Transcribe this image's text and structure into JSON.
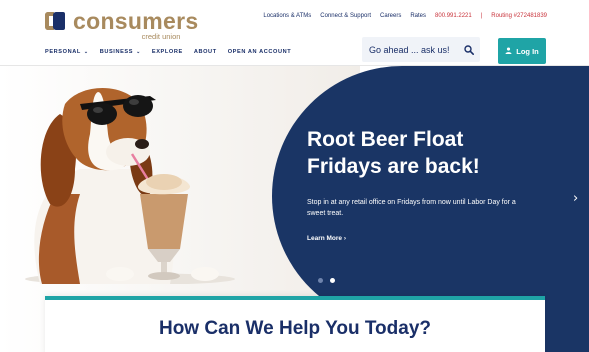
{
  "brand": {
    "name": "consumers",
    "tagline": "credit union",
    "colors": {
      "gold": "#a88a5e",
      "navy": "#1a2f68",
      "teal": "#1fa4a6",
      "red": "#c8323a",
      "hero_blue": "#1a3565"
    }
  },
  "utility_nav": {
    "links": [
      "Locations & ATMs",
      "Connect & Support",
      "Careers",
      "Rates"
    ],
    "phone": "800.991.2221",
    "separator": "|",
    "routing": "Routing #272481839"
  },
  "main_nav": {
    "items": [
      {
        "label": "PERSONAL",
        "has_dropdown": true
      },
      {
        "label": "BUSINESS",
        "has_dropdown": true
      },
      {
        "label": "EXPLORE",
        "has_dropdown": false
      },
      {
        "label": "ABOUT",
        "has_dropdown": false
      },
      {
        "label": "OPEN AN ACCOUNT",
        "has_dropdown": false
      }
    ]
  },
  "search": {
    "placeholder": "Go ahead ... ask us!",
    "icon": "search-icon"
  },
  "login": {
    "label": "Log In",
    "icon": "user-icon"
  },
  "hero": {
    "title_line1": "Root Beer Float",
    "title_line2": "Fridays are back!",
    "body": "Stop in at any retail office on Fridays from now until Labor Day for a sweet treat.",
    "link": "Learn More",
    "link_icon": "chevron-right-icon",
    "next_icon": "chevron-right-icon",
    "slides": 2,
    "active_slide": 2
  },
  "help": {
    "title": "How Can We Help You Today?"
  }
}
